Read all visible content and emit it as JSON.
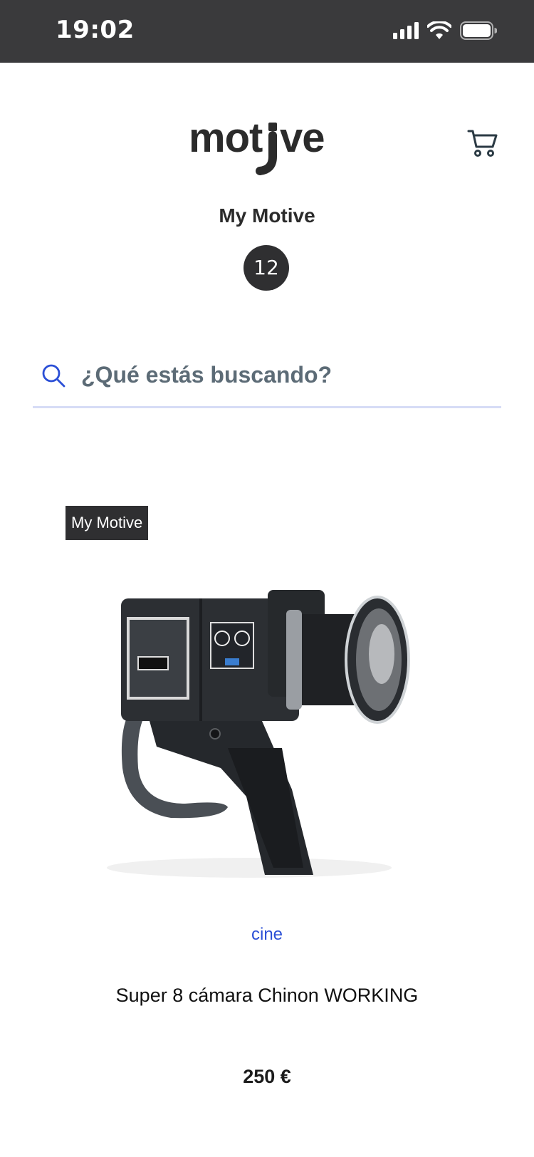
{
  "status_bar": {
    "time": "19:02"
  },
  "header": {
    "logo_text": "motive"
  },
  "collection": {
    "title": "My Motive",
    "count": "12"
  },
  "search": {
    "placeholder": "¿Qué estás buscando?"
  },
  "product": {
    "tag": "My Motive",
    "category": "cine",
    "name": "Super 8 cámara Chinon WORKING",
    "price": "250 €"
  },
  "icons": [
    "signal-icon",
    "wifi-icon",
    "battery-icon",
    "cart-icon",
    "search-icon"
  ],
  "colors": {
    "status_bar": "#3a3a3c",
    "accent_blue": "#2b4fd6",
    "badge": "#2f2f31",
    "search_underline": "#d6dcf6"
  }
}
